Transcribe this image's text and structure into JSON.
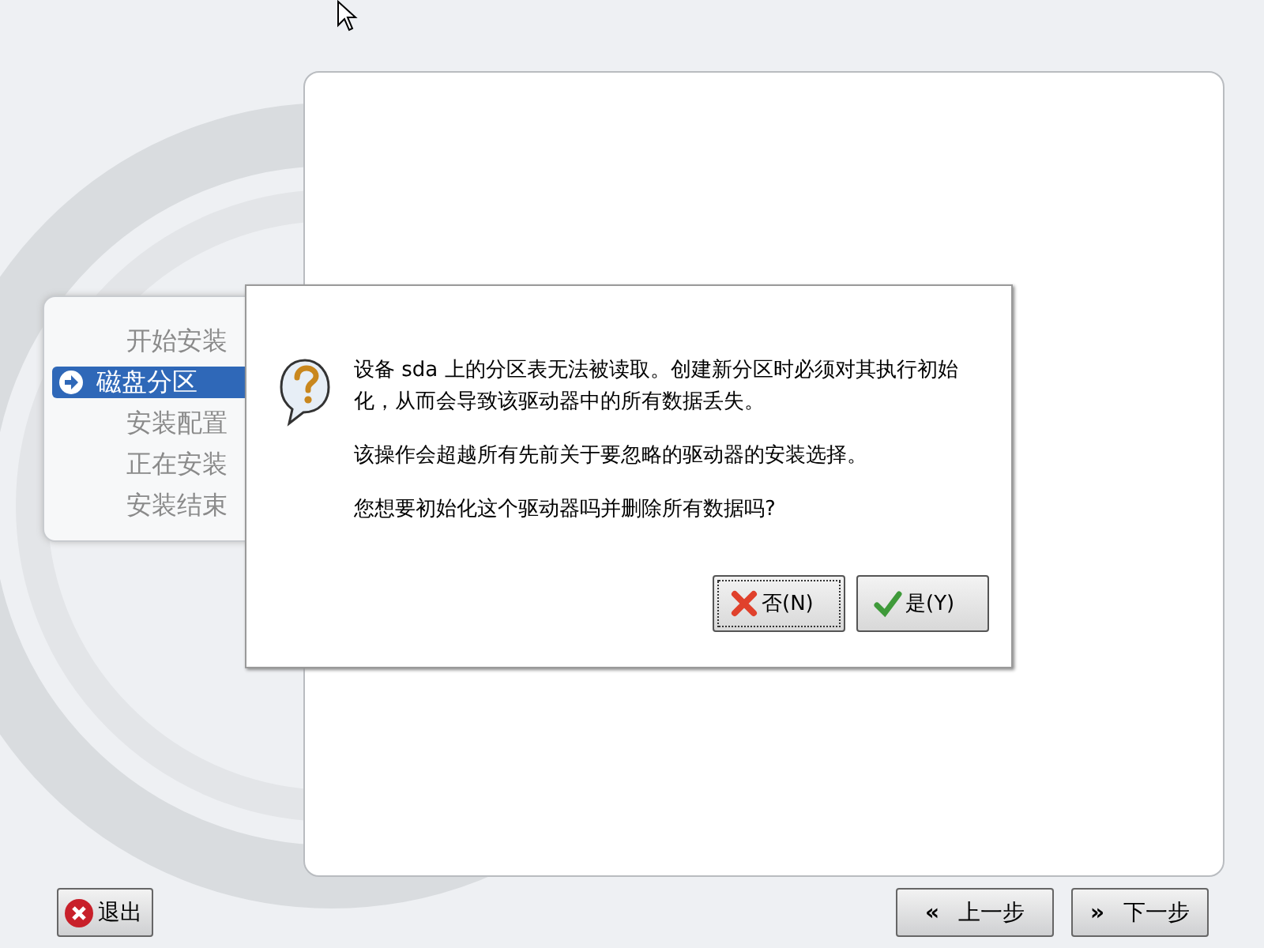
{
  "steps": [
    {
      "label": "开始安装",
      "selected": false
    },
    {
      "label": "磁盘分区",
      "selected": true
    },
    {
      "label": "安装配置",
      "selected": false
    },
    {
      "label": "正在安装",
      "selected": false
    },
    {
      "label": "安装结束",
      "selected": false
    }
  ],
  "dialog": {
    "paragraphs": [
      "设备 sda 上的分区表无法被读取。创建新分区时必须对其执行初始化，从而会导致该驱动器中的所有数据丢失。",
      "该操作会超越所有先前关于要忽略的驱动器的安装选择。",
      "您想要初始化这个驱动器吗并删除所有数据吗?"
    ],
    "buttons": [
      {
        "kind": "no",
        "label": "否(N)",
        "focused": true
      },
      {
        "kind": "yes",
        "label": "是(Y)",
        "focused": false
      }
    ]
  },
  "footer": {
    "quit": {
      "label": "退出"
    },
    "back": {
      "icon": "«",
      "label": "上一步"
    },
    "next": {
      "icon": "»",
      "label": "下一步"
    }
  }
}
